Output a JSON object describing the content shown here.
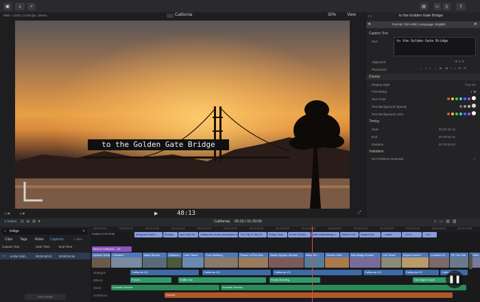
{
  "toolbar": {
    "project_title": "California",
    "zoom": "30%",
    "view_label": "View",
    "inspector_title": "to the Golden Gate Bridge"
  },
  "viewer": {
    "format_info": "7680 × 4320 | 23.98 fps, Stereo",
    "caption_text": "to the Golden Gate Bridge",
    "timecode": "48:13"
  },
  "inspector": {
    "format": "Format: CEA-608  |  Language: English",
    "caption_section": "Caption Text",
    "text_label": "Text",
    "text_value": "to the Golden Gate Bridge",
    "alignment_label": "Alignment",
    "placement_label": "Placement",
    "display_section": "Display",
    "display_style_label": "Display Style",
    "display_style_value": "Pop-On",
    "formatting_label": "Formatting",
    "text_color_label": "Text Color",
    "bg_opacity_label": "Text Background Opacity",
    "bg_color_label": "Text Background Color",
    "timing_section": "Timing",
    "start_label": "Start",
    "start_value": "00:00:48:13",
    "end_label": "End",
    "end_value": "00:00:53:16",
    "duration_label": "Duration",
    "duration_value": "00:00:05:03",
    "validation_section": "Validation",
    "validation_text": "No Problems Detected",
    "colors": [
      "#e84a4a",
      "#f0d030",
      "#4ad04a",
      "#4ad0e0",
      "#4a70f0",
      "#c04ae0",
      "#ffffff"
    ]
  },
  "timeline_bar": {
    "index_label": "Index",
    "project": "California",
    "timecode": "05:03 / 01:29:06"
  },
  "index": {
    "search_value": "bridge",
    "tabs": [
      "Clips",
      "Tags",
      "Roles",
      "Captions"
    ],
    "count": "1 item",
    "headers": [
      "Caption Text",
      "Start Time",
      "End Time"
    ],
    "row": {
      "text": "to the Gold...",
      "start": "00:00:48:13",
      "end": "00:00:53:16"
    },
    "view_button": "View Roles"
  },
  "timeline": {
    "ruler": [
      "00:00:00:00",
      "00:00:05:00",
      "00:00:10:00",
      "00:00:15:00",
      "00:00:20:00",
      "00:00:25:00",
      "00:00:30:00",
      "00:00:35:00",
      "00:00:40:00",
      "00:00:45:00",
      "00:00:50:00",
      "00:00:55:00",
      "00:01:00:00",
      "00:01:05:00",
      "00:01:10:00"
    ],
    "caption_role": "English (CEA-608)",
    "captions": [
      "Along the North...",
      "Beauty...",
      "and Lake Ta...",
      "California's iconic landmarks are symb...",
      "The City of San Fr...",
      "Bridge Stan...",
      "to the Golden...",
      "with breathtaking v...",
      "Where Coll...",
      "Mojave De...",
      "...under...",
      "...rn fo...",
      "...ver..."
    ],
    "compound_clip": "Best of California – 30",
    "video_clips": [
      "Avenue Sunb...",
      "Coastline",
      "Misty Shores",
      "Redwoo...",
      "Lake Tahoe",
      "Ferry Building",
      "Palace of Fine Arts",
      "Alamo Square Sunrise",
      "Bixby Bri...",
      "Golden Gate",
      "Bay Bridge Sunset",
      "Coit Tower",
      "Mojave Desert",
      "Lombard St.",
      "SF City Hall",
      "SOMA..."
    ],
    "voice_label": "Dialogue",
    "voice_clips": [
      "California VO",
      "California VO",
      "California VO",
      "California VO",
      "California VO",
      "California VO"
    ],
    "effects_label": "Effects",
    "effects_clips": [
      "Forest",
      "Traffic City",
      "Forest Evening",
      "City Night Crowd"
    ],
    "music_label": "Music",
    "music_clips": [
      "Acoustic Sunrise",
      "Acoustic Sunrise"
    ],
    "ambience_label": "Ambience",
    "ambience_clip": "Sunrise"
  }
}
